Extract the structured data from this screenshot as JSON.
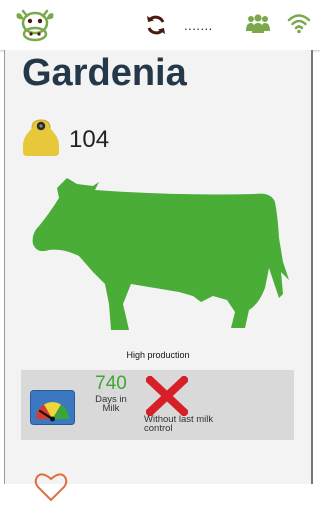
{
  "header": {
    "logo_icon": "cow-face-logo",
    "sync_icon": "sync-icon",
    "status_text": ".......",
    "herd_icon": "herd-group-icon",
    "wifi_icon": "wifi-icon",
    "accent_color": "#7aa84a",
    "sync_color": "#4a1a10"
  },
  "animal": {
    "name": "Gardenia",
    "ear_tag_icon": "ear-tag-icon",
    "tag_number": "104",
    "silhouette_color": "#49ad37",
    "production_label": "High production"
  },
  "stats": {
    "gauge_icon": "production-gauge-icon",
    "days_in_milk_value": "740",
    "days_in_milk_label": "Days in Milk",
    "milk_control_icon": "red-x-icon",
    "milk_control_label": "Without last milk control"
  },
  "footer": {
    "favorite_icon": "heart-icon",
    "favorite_color": "#e0703a"
  }
}
